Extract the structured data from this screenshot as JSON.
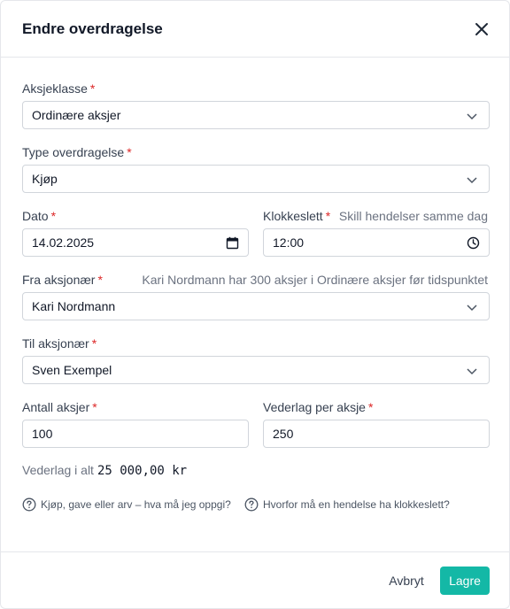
{
  "dialog": {
    "title": "Endre overdragelse",
    "close_icon": "close-icon"
  },
  "required_marker": "*",
  "fields": {
    "share_class": {
      "label": "Aksjeklasse",
      "value": "Ordinære aksjer"
    },
    "transfer_type": {
      "label": "Type overdragelse",
      "value": "Kjøp"
    },
    "date": {
      "label": "Dato",
      "value": "14.02.2025"
    },
    "time": {
      "label": "Klokkeslett",
      "value": "12:00",
      "hint": "Skill hendelser samme dag"
    },
    "from_shareholder": {
      "label": "Fra aksjonær",
      "value": "Kari Nordmann",
      "hint": "Kari Nordmann har 300 aksjer i Ordinære aksjer før tidspunktet"
    },
    "to_shareholder": {
      "label": "Til aksjonær",
      "value": "Sven Exempel"
    },
    "share_count": {
      "label": "Antall aksjer",
      "value": "100"
    },
    "price_per_share": {
      "label": "Vederlag per aksje",
      "value": "250"
    }
  },
  "total": {
    "label": "Vederlag i alt",
    "value": "25 000,00 kr"
  },
  "help_links": [
    {
      "label": "Kjøp, gave eller arv – hva må jeg oppgi?"
    },
    {
      "label": "Hvorfor må en hendelse ha klokkeslett?"
    }
  ],
  "footer": {
    "cancel_label": "Avbryt",
    "save_label": "Lagre"
  },
  "colors": {
    "accent": "#14b8a6",
    "required": "#dc2626"
  }
}
